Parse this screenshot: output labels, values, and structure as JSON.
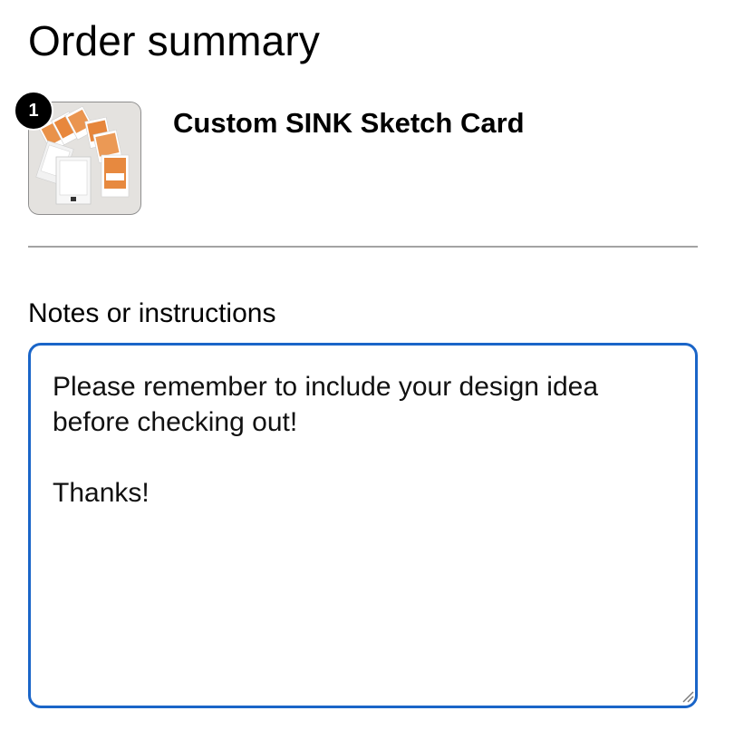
{
  "order_summary": {
    "title": "Order summary",
    "items": [
      {
        "quantity": "1",
        "name": "Custom SINK Sketch Card",
        "thumbnail": "product-thumbnail"
      }
    ]
  },
  "notes": {
    "label": "Notes or instructions",
    "value": "Please remember to include your design idea\nbefore checking out!\n\nThanks!"
  },
  "colors": {
    "focus_border": "#1a65c8",
    "divider": "#a3a3a3",
    "badge": "#000000"
  },
  "icons": {
    "resize": "resize-grip-icon"
  }
}
